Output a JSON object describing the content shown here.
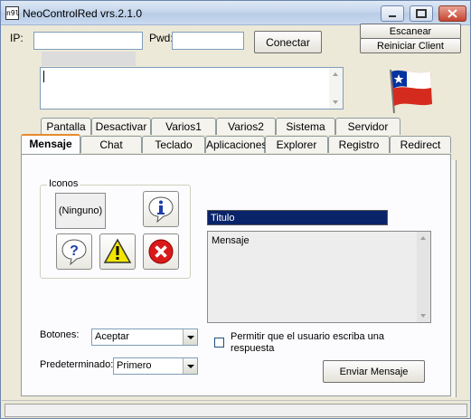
{
  "window": {
    "title": "NeoControlRed vrs.2.1.0",
    "app_icon_text": "n9l"
  },
  "connection": {
    "ip_label": "IP:",
    "ip_value": "",
    "pwd_label": "Pwd:",
    "pwd_value": "",
    "connect_label": "Conectar",
    "scan_label": "Escanear",
    "restart_label": "Reiniciar Client"
  },
  "log_text": "",
  "tabs_row1": [
    {
      "label": "Pantalla"
    },
    {
      "label": "Desactivar"
    },
    {
      "label": "Varios1"
    },
    {
      "label": "Varios2"
    },
    {
      "label": "Sistema"
    },
    {
      "label": "Servidor"
    }
  ],
  "tabs_row2": [
    {
      "label": "Mensaje",
      "active": true
    },
    {
      "label": "Chat"
    },
    {
      "label": "Teclado"
    },
    {
      "label": "Aplicaciones"
    },
    {
      "label": "Explorer"
    },
    {
      "label": "Registro"
    },
    {
      "label": "Redirect"
    }
  ],
  "mensaje": {
    "icons_group_title": "Iconos",
    "selected_icon_label": "(Ninguno)",
    "icons": [
      "info-icon",
      "question-icon",
      "warning-icon",
      "error-icon"
    ],
    "title_value": "Titulo",
    "message_value": "Mensaje",
    "buttons_label": "Botones:",
    "buttons_value": "Aceptar",
    "default_label": "Predeterminado:",
    "default_value": "Primero",
    "allow_reply_label": "Permitir que el usuario escriba una respuesta",
    "allow_reply_checked": false,
    "send_label": "Enviar Mensaje"
  },
  "status_text": "",
  "colors": {
    "title_field_bg": "#0a246a",
    "active_tab_accent": "#e68b2c",
    "error_red": "#d91a1a",
    "warning_yellow": "#f2e600",
    "info_blue": "#1c3fa8"
  }
}
